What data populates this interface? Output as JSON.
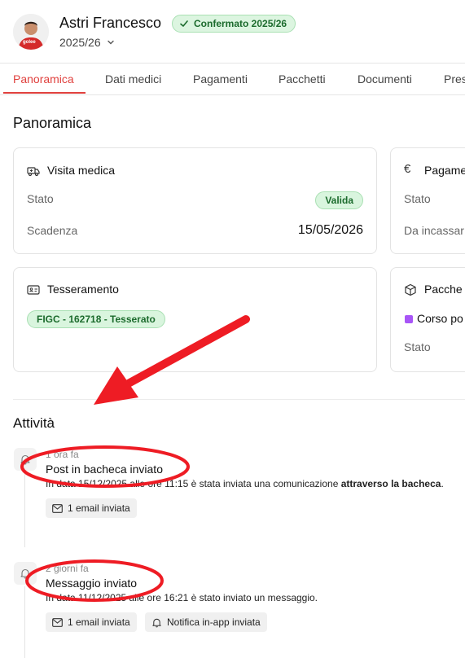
{
  "header": {
    "name": "Astri Francesco",
    "status_badge": "Confermato 2025/26",
    "season": "2025/26",
    "avatar_text": "golee"
  },
  "tabs": [
    "Panoramica",
    "Dati medici",
    "Pagamenti",
    "Pacchetti",
    "Documenti",
    "Pres"
  ],
  "section_title": "Panoramica",
  "cards": {
    "visita": {
      "title": "Visita medica",
      "stato_label": "Stato",
      "stato_value": "Valida",
      "scadenza_label": "Scadenza",
      "scadenza_value": "15/05/2026"
    },
    "pagamenti": {
      "title": "Pagame",
      "stato_label": "Stato",
      "incassare_label": "Da incassar"
    },
    "tesseramento": {
      "title": "Tesseramento",
      "badge": "FIGC - 162718 - Tesserato"
    },
    "pacchetti": {
      "title": "Pacche",
      "item": "Corso po",
      "stato_label": "Stato"
    }
  },
  "activity": {
    "title": "Attività",
    "items": [
      {
        "time": "1 ora fa",
        "title": "Post in bacheca inviato",
        "desc_before": "In data 15/12/2025 alle ore 11:15 è stata inviata una comunicazione ",
        "desc_bold": "attraverso la bacheca",
        "desc_after": ".",
        "chip_email": "1 email inviata"
      },
      {
        "time": "2 giorni fa",
        "title": "Messaggio inviato",
        "desc": "In data 11/12/2025 alle ore 16:21 è stato inviato un messaggio.",
        "chip_email": "1 email inviata",
        "chip_notify": "Notifica in-app inviata"
      }
    ]
  },
  "colors": {
    "accent": "#e0413e",
    "success_bg": "#d9f5de",
    "success_text": "#1c6b2d",
    "annotation": "#ee1c24",
    "package_dot": "#a855f7"
  }
}
